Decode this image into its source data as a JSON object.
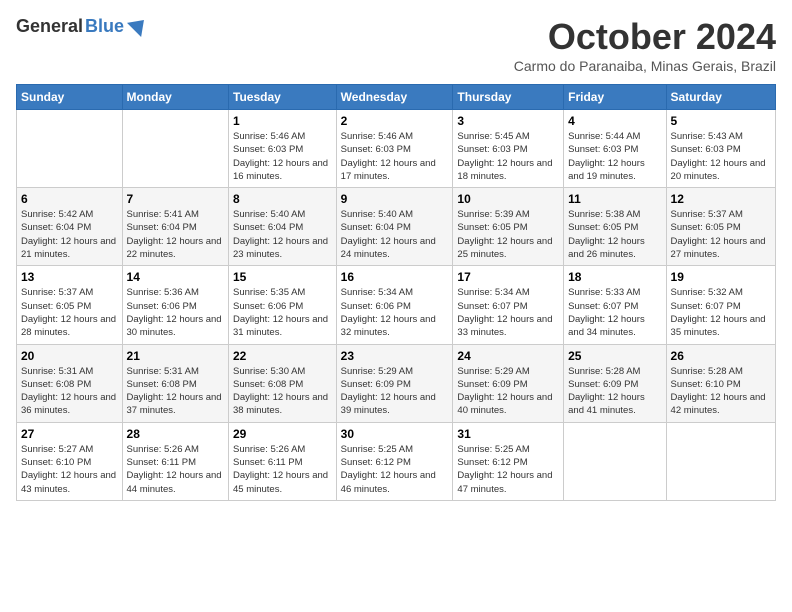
{
  "logo": {
    "general": "General",
    "blue": "Blue"
  },
  "title": "October 2024",
  "location": "Carmo do Paranaiba, Minas Gerais, Brazil",
  "days_of_week": [
    "Sunday",
    "Monday",
    "Tuesday",
    "Wednesday",
    "Thursday",
    "Friday",
    "Saturday"
  ],
  "weeks": [
    [
      {
        "day": "",
        "sunrise": "",
        "sunset": "",
        "daylight": ""
      },
      {
        "day": "",
        "sunrise": "",
        "sunset": "",
        "daylight": ""
      },
      {
        "day": "1",
        "sunrise": "Sunrise: 5:46 AM",
        "sunset": "Sunset: 6:03 PM",
        "daylight": "Daylight: 12 hours and 16 minutes."
      },
      {
        "day": "2",
        "sunrise": "Sunrise: 5:46 AM",
        "sunset": "Sunset: 6:03 PM",
        "daylight": "Daylight: 12 hours and 17 minutes."
      },
      {
        "day": "3",
        "sunrise": "Sunrise: 5:45 AM",
        "sunset": "Sunset: 6:03 PM",
        "daylight": "Daylight: 12 hours and 18 minutes."
      },
      {
        "day": "4",
        "sunrise": "Sunrise: 5:44 AM",
        "sunset": "Sunset: 6:03 PM",
        "daylight": "Daylight: 12 hours and 19 minutes."
      },
      {
        "day": "5",
        "sunrise": "Sunrise: 5:43 AM",
        "sunset": "Sunset: 6:03 PM",
        "daylight": "Daylight: 12 hours and 20 minutes."
      }
    ],
    [
      {
        "day": "6",
        "sunrise": "Sunrise: 5:42 AM",
        "sunset": "Sunset: 6:04 PM",
        "daylight": "Daylight: 12 hours and 21 minutes."
      },
      {
        "day": "7",
        "sunrise": "Sunrise: 5:41 AM",
        "sunset": "Sunset: 6:04 PM",
        "daylight": "Daylight: 12 hours and 22 minutes."
      },
      {
        "day": "8",
        "sunrise": "Sunrise: 5:40 AM",
        "sunset": "Sunset: 6:04 PM",
        "daylight": "Daylight: 12 hours and 23 minutes."
      },
      {
        "day": "9",
        "sunrise": "Sunrise: 5:40 AM",
        "sunset": "Sunset: 6:04 PM",
        "daylight": "Daylight: 12 hours and 24 minutes."
      },
      {
        "day": "10",
        "sunrise": "Sunrise: 5:39 AM",
        "sunset": "Sunset: 6:05 PM",
        "daylight": "Daylight: 12 hours and 25 minutes."
      },
      {
        "day": "11",
        "sunrise": "Sunrise: 5:38 AM",
        "sunset": "Sunset: 6:05 PM",
        "daylight": "Daylight: 12 hours and 26 minutes."
      },
      {
        "day": "12",
        "sunrise": "Sunrise: 5:37 AM",
        "sunset": "Sunset: 6:05 PM",
        "daylight": "Daylight: 12 hours and 27 minutes."
      }
    ],
    [
      {
        "day": "13",
        "sunrise": "Sunrise: 5:37 AM",
        "sunset": "Sunset: 6:05 PM",
        "daylight": "Daylight: 12 hours and 28 minutes."
      },
      {
        "day": "14",
        "sunrise": "Sunrise: 5:36 AM",
        "sunset": "Sunset: 6:06 PM",
        "daylight": "Daylight: 12 hours and 30 minutes."
      },
      {
        "day": "15",
        "sunrise": "Sunrise: 5:35 AM",
        "sunset": "Sunset: 6:06 PM",
        "daylight": "Daylight: 12 hours and 31 minutes."
      },
      {
        "day": "16",
        "sunrise": "Sunrise: 5:34 AM",
        "sunset": "Sunset: 6:06 PM",
        "daylight": "Daylight: 12 hours and 32 minutes."
      },
      {
        "day": "17",
        "sunrise": "Sunrise: 5:34 AM",
        "sunset": "Sunset: 6:07 PM",
        "daylight": "Daylight: 12 hours and 33 minutes."
      },
      {
        "day": "18",
        "sunrise": "Sunrise: 5:33 AM",
        "sunset": "Sunset: 6:07 PM",
        "daylight": "Daylight: 12 hours and 34 minutes."
      },
      {
        "day": "19",
        "sunrise": "Sunrise: 5:32 AM",
        "sunset": "Sunset: 6:07 PM",
        "daylight": "Daylight: 12 hours and 35 minutes."
      }
    ],
    [
      {
        "day": "20",
        "sunrise": "Sunrise: 5:31 AM",
        "sunset": "Sunset: 6:08 PM",
        "daylight": "Daylight: 12 hours and 36 minutes."
      },
      {
        "day": "21",
        "sunrise": "Sunrise: 5:31 AM",
        "sunset": "Sunset: 6:08 PM",
        "daylight": "Daylight: 12 hours and 37 minutes."
      },
      {
        "day": "22",
        "sunrise": "Sunrise: 5:30 AM",
        "sunset": "Sunset: 6:08 PM",
        "daylight": "Daylight: 12 hours and 38 minutes."
      },
      {
        "day": "23",
        "sunrise": "Sunrise: 5:29 AM",
        "sunset": "Sunset: 6:09 PM",
        "daylight": "Daylight: 12 hours and 39 minutes."
      },
      {
        "day": "24",
        "sunrise": "Sunrise: 5:29 AM",
        "sunset": "Sunset: 6:09 PM",
        "daylight": "Daylight: 12 hours and 40 minutes."
      },
      {
        "day": "25",
        "sunrise": "Sunrise: 5:28 AM",
        "sunset": "Sunset: 6:09 PM",
        "daylight": "Daylight: 12 hours and 41 minutes."
      },
      {
        "day": "26",
        "sunrise": "Sunrise: 5:28 AM",
        "sunset": "Sunset: 6:10 PM",
        "daylight": "Daylight: 12 hours and 42 minutes."
      }
    ],
    [
      {
        "day": "27",
        "sunrise": "Sunrise: 5:27 AM",
        "sunset": "Sunset: 6:10 PM",
        "daylight": "Daylight: 12 hours and 43 minutes."
      },
      {
        "day": "28",
        "sunrise": "Sunrise: 5:26 AM",
        "sunset": "Sunset: 6:11 PM",
        "daylight": "Daylight: 12 hours and 44 minutes."
      },
      {
        "day": "29",
        "sunrise": "Sunrise: 5:26 AM",
        "sunset": "Sunset: 6:11 PM",
        "daylight": "Daylight: 12 hours and 45 minutes."
      },
      {
        "day": "30",
        "sunrise": "Sunrise: 5:25 AM",
        "sunset": "Sunset: 6:12 PM",
        "daylight": "Daylight: 12 hours and 46 minutes."
      },
      {
        "day": "31",
        "sunrise": "Sunrise: 5:25 AM",
        "sunset": "Sunset: 6:12 PM",
        "daylight": "Daylight: 12 hours and 47 minutes."
      },
      {
        "day": "",
        "sunrise": "",
        "sunset": "",
        "daylight": ""
      },
      {
        "day": "",
        "sunrise": "",
        "sunset": "",
        "daylight": ""
      }
    ]
  ]
}
